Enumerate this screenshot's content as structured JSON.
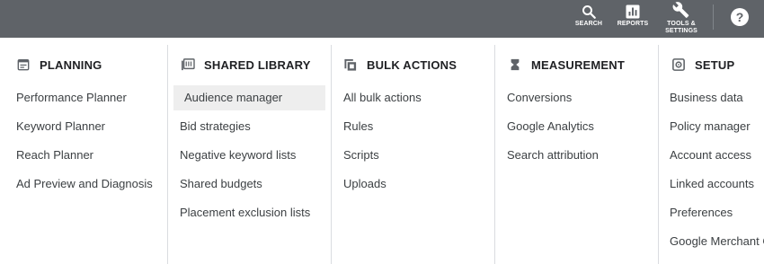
{
  "topbar": {
    "search_label": "SEARCH",
    "reports_label": "REPORTS",
    "tools_label_line1": "TOOLS &",
    "tools_label_line2": "SETTINGS",
    "help_glyph": "?",
    "icons": {
      "search": "search-icon",
      "reports": "bar-chart-icon",
      "tools": "wrench-icon",
      "help": "help-icon"
    },
    "background_color": "#5f6368"
  },
  "columns": [
    {
      "heading": "PLANNING",
      "icon": "calendar-icon",
      "items": [
        "Performance Planner",
        "Keyword Planner",
        "Reach Planner",
        "Ad Preview and Diagnosis"
      ]
    },
    {
      "heading": "SHARED LIBRARY",
      "icon": "library-icon",
      "items": [
        "Audience manager",
        "Bid strategies",
        "Negative keyword lists",
        "Shared budgets",
        "Placement exclusion lists"
      ],
      "highlighted_item": "Audience manager"
    },
    {
      "heading": "BULK ACTIONS",
      "icon": "copy-stack-icon",
      "items": [
        "All bulk actions",
        "Rules",
        "Scripts",
        "Uploads"
      ]
    },
    {
      "heading": "MEASUREMENT",
      "icon": "hourglass-icon",
      "items": [
        "Conversions",
        "Google Analytics",
        "Search attribution"
      ]
    },
    {
      "heading": "SETUP",
      "icon": "settings-box-icon",
      "items": [
        "Business data",
        "Policy manager",
        "Account access",
        "Linked accounts",
        "Preferences",
        "Google Merchant C"
      ]
    }
  ],
  "colors": {
    "highlight": "#eeeeee",
    "text": "#3c4043",
    "heading": "#202124"
  }
}
